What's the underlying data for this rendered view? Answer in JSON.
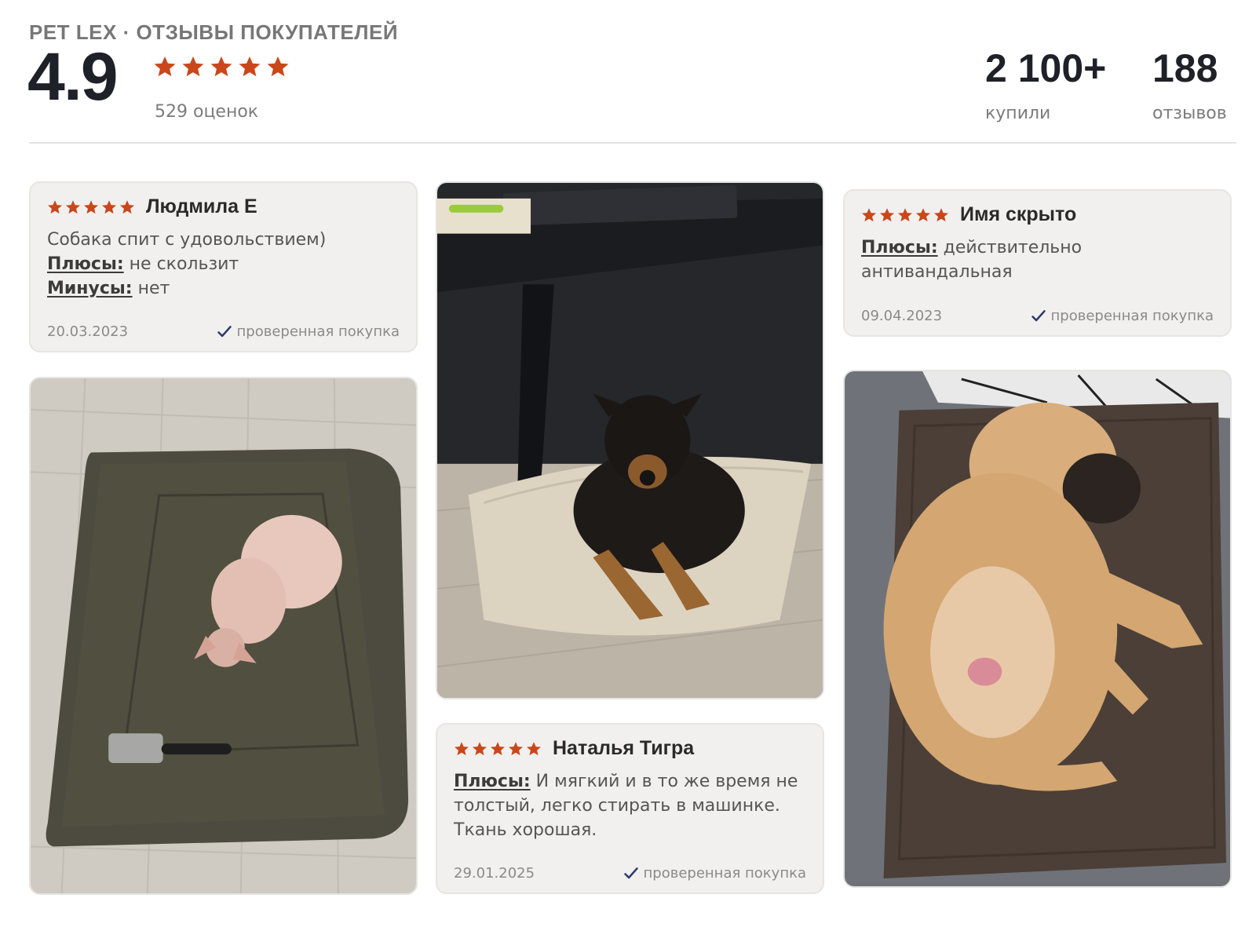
{
  "header": {
    "brand": "PET LEX · ОТЗЫВЫ ПОКУПАТЕЛЕЙ",
    "rating": "4.9",
    "ratings_count": "529 оценок",
    "bought_value": "2 100+",
    "bought_label": "купили",
    "reviews_value": "188",
    "reviews_label": "отзывов"
  },
  "colors": {
    "star": "#c9471b",
    "check": "#2b3a6b",
    "card_bg": "#f1f0ee"
  },
  "reviews": [
    {
      "stars": 5,
      "author": "Людмила Е",
      "text": "Собака спит с удовольствием)",
      "pros_label": "Плюсы:",
      "pros": "не скользит",
      "cons_label": "Минусы:",
      "cons": "нет",
      "date": "20.03.2023",
      "verified": "проверенная покупка"
    },
    {
      "stars": 5,
      "author": "Имя скрыто",
      "pros_label": "Плюсы:",
      "pros": "действительно антивандальная",
      "date": "09.04.2023",
      "verified": "проверенная покупка"
    },
    {
      "stars": 5,
      "author": "Наталья Тигра",
      "pros_label": "Плюсы:",
      "pros": "И мягкий и в то же время не толстый, легко стирать в машинке. Ткань хорошая.",
      "date": "29.01.2025",
      "verified": "проверенная покупка"
    }
  ],
  "icons": {
    "star": "star-icon",
    "verified": "check-icon"
  }
}
